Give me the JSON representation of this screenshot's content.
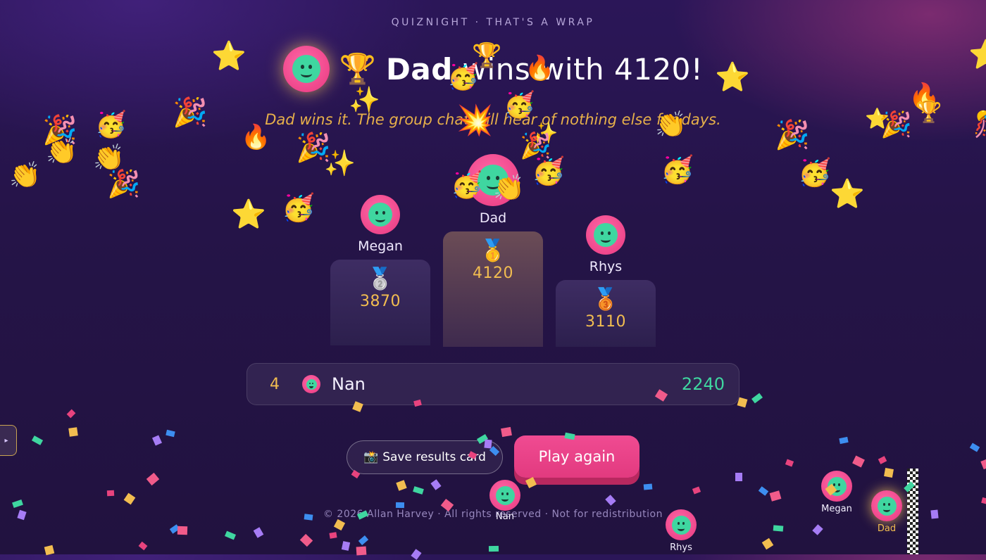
{
  "eyebrow": "QUIZNIGHT · THAT'S A WRAP",
  "headline": {
    "trophy": "🏆",
    "winner": "Dad",
    "rest": " wins with 4120!"
  },
  "tagline": "Dad wins it. The group chat will hear of nothing else for days.",
  "podium": [
    {
      "place": 2,
      "name": "Megan",
      "medal": "🥈",
      "score": "3870"
    },
    {
      "place": 1,
      "name": "Dad",
      "medal": "🥇",
      "score": "4120"
    },
    {
      "place": 3,
      "name": "Rhys",
      "medal": "🥉",
      "score": "3110"
    }
  ],
  "others": [
    {
      "rank": "4",
      "name": "Nan",
      "score": "2240"
    }
  ],
  "buttons": {
    "save": "Save results card",
    "save_icon": "📸",
    "play": "Play again"
  },
  "footer": "© 2026 Allan Harvey · All rights reserved · Not for redistribution",
  "side_tab": "▸",
  "race": [
    {
      "name": "Nan"
    },
    {
      "name": "Rhys"
    },
    {
      "name": "Megan"
    },
    {
      "name": "Dad",
      "leader": true
    }
  ],
  "colors": {
    "gold": "#f2bd50",
    "pink": "#e8377f",
    "mint": "#3fd6a0"
  }
}
